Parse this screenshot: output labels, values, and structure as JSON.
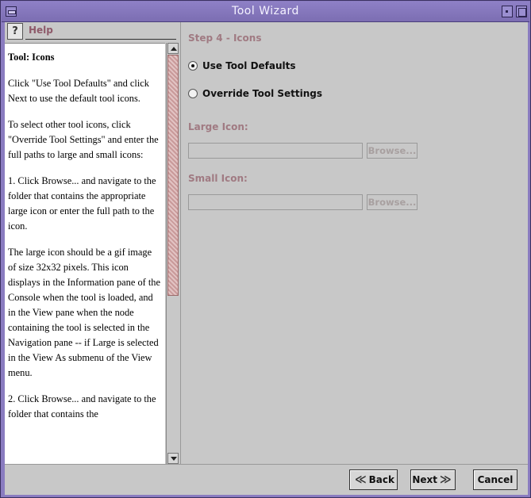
{
  "window": {
    "title": "Tool Wizard"
  },
  "help": {
    "title": "Help",
    "heading": "Tool: Icons",
    "paragraphs": [
      "Click \"Use Tool Defaults\" and click Next to use the default tool icons.",
      "To select other tool icons, click \"Override Tool Settings\" and enter the full paths to large and small icons:",
      "1. Click Browse... and navigate to the folder that contains the appropriate large icon or enter the full path to the icon.",
      "The large icon should be a gif image of size 32x32 pixels. This icon displays in the Information pane of the Console when the tool is loaded, and in the View pane when the node containing the tool is selected in the Navigation pane -- if Large is selected in the View As submenu of the View menu.",
      "2. Click Browse... and navigate to the folder that contains the"
    ]
  },
  "step": {
    "title": "Step 4 - Icons",
    "option_defaults": "Use Tool Defaults",
    "option_override": "Override Tool Settings",
    "selected": "Use Tool Defaults",
    "large_icon_label": "Large Icon:",
    "large_icon_value": "",
    "small_icon_label": "Small Icon:",
    "small_icon_value": "",
    "browse_label": "Browse..."
  },
  "buttons": {
    "back": "Back",
    "next": "Next",
    "cancel": "Cancel"
  },
  "colors": {
    "titlebar": "#8a7cc0",
    "accent_label": "#a07a82",
    "panel": "#c8c8c8"
  }
}
